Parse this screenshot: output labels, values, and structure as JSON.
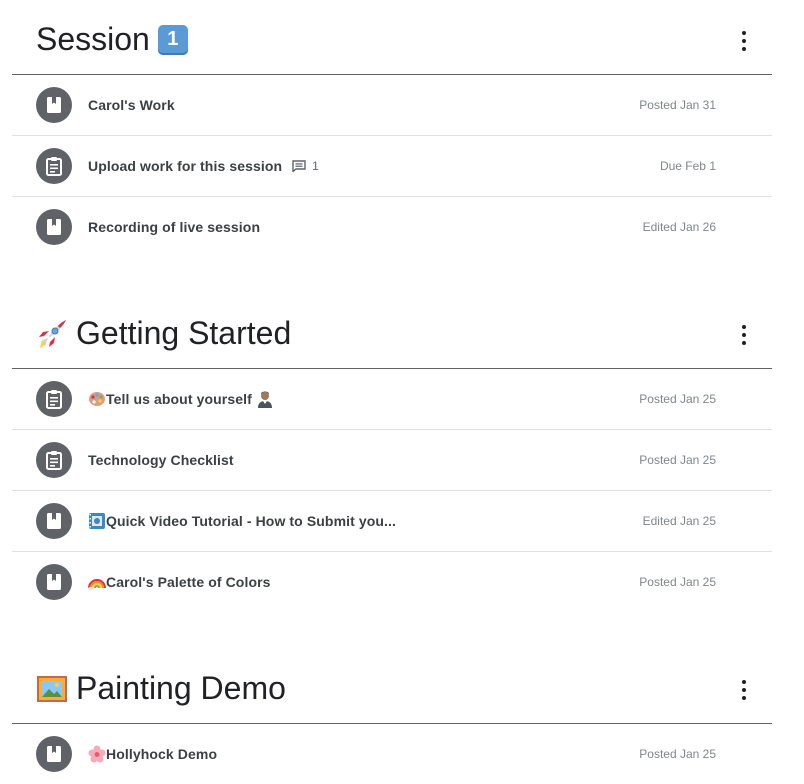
{
  "topics": [
    {
      "title": "Session",
      "title_badge": "1",
      "items": [
        {
          "type": "material",
          "title": "Carol's Work",
          "meta": "Posted Jan 31"
        },
        {
          "type": "assignment",
          "title": "Upload work for this session",
          "comments": "1",
          "meta": "Due Feb 1"
        },
        {
          "type": "material",
          "title": "Recording of live session",
          "meta": "Edited Jan 26"
        }
      ]
    },
    {
      "title": "Getting Started",
      "title_emoji": "rocket-icon",
      "items": [
        {
          "type": "assignment",
          "title": "Tell us about yourself",
          "lead_emoji": "palette-icon",
          "trail_emoji": "person-icon",
          "meta": "Posted Jan 25"
        },
        {
          "type": "assignment",
          "title": "Technology Checklist",
          "meta": "Posted Jan 25"
        },
        {
          "type": "material",
          "title": "Quick Video Tutorial - How to Submit you...",
          "lead_emoji": "film-frames-icon",
          "meta": "Edited Jan 25"
        },
        {
          "type": "material",
          "title": "Carol's Palette of Colors",
          "lead_emoji": "rainbow-icon",
          "meta": "Posted Jan 25"
        }
      ]
    },
    {
      "title": "Painting Demo",
      "title_emoji": "framed-picture-icon",
      "items": [
        {
          "type": "material",
          "title": "Hollyhock Demo",
          "lead_emoji": "blossom-icon",
          "meta": "Posted Jan 25"
        }
      ]
    }
  ],
  "colors": {
    "icon_circle": "#5f6368",
    "divider": "#e0e0e0",
    "header_rule": "#5f6368"
  }
}
